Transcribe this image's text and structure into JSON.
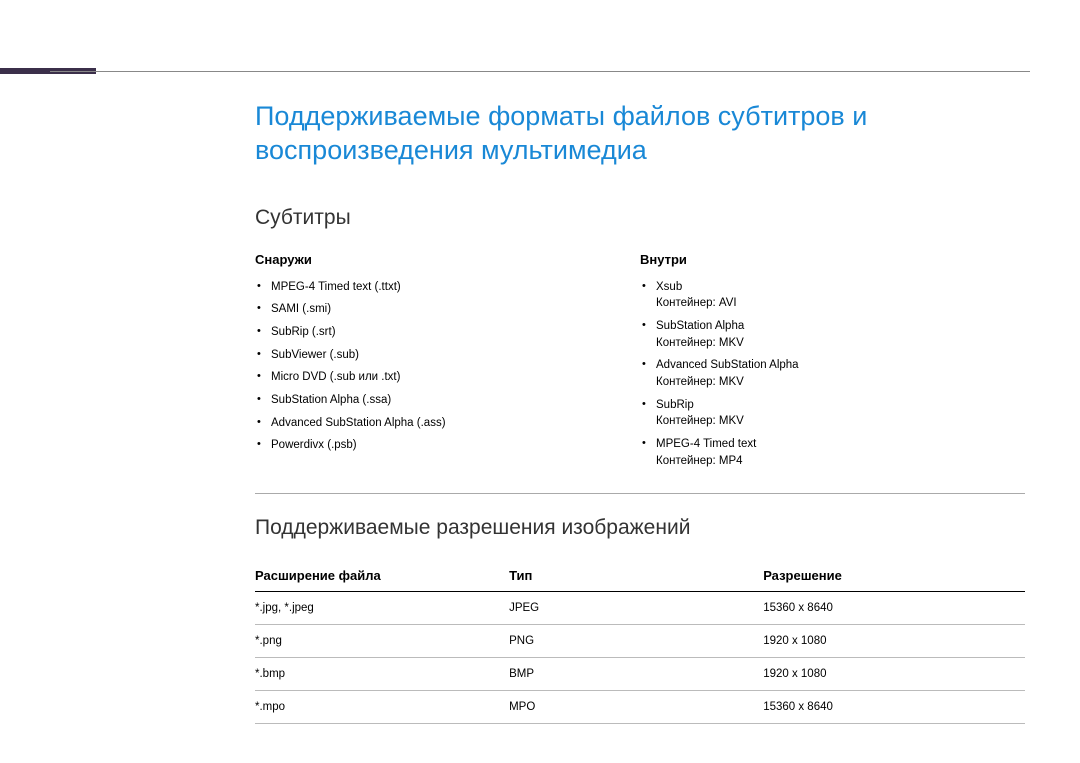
{
  "title": "Поддерживаемые форматы файлов субтитров и воспроизведения мультимедиа",
  "subtitles_heading": "Субтитры",
  "external": {
    "header": "Снаружи",
    "items": [
      "MPEG-4 Timed text (.ttxt)",
      "SAMI (.smi)",
      "SubRip (.srt)",
      "SubViewer (.sub)",
      "Micro DVD (.sub или .txt)",
      "SubStation Alpha (.ssa)",
      "Advanced SubStation Alpha (.ass)",
      "Powerdivx (.psb)"
    ]
  },
  "internal": {
    "header": "Внутри",
    "items": [
      {
        "name": "Xsub",
        "container": "Контейнер: AVI"
      },
      {
        "name": "SubStation Alpha",
        "container": "Контейнер: MKV"
      },
      {
        "name": "Advanced SubStation Alpha",
        "container": "Контейнер: MKV"
      },
      {
        "name": "SubRip",
        "container": "Контейнер: MKV"
      },
      {
        "name": "MPEG-4 Timed text",
        "container": "Контейнер: MP4"
      }
    ]
  },
  "resolutions_heading": "Поддерживаемые разрешения изображений",
  "table": {
    "headers": {
      "ext": "Расширение файла",
      "type": "Тип",
      "res": "Разрешение"
    },
    "rows": [
      {
        "ext": "*.jpg, *.jpeg",
        "type": "JPEG",
        "res": "15360 x 8640"
      },
      {
        "ext": "*.png",
        "type": "PNG",
        "res": "1920 x 1080"
      },
      {
        "ext": "*.bmp",
        "type": "BMP",
        "res": "1920 x 1080"
      },
      {
        "ext": "*.mpo",
        "type": "MPO",
        "res": "15360 x 8640"
      }
    ]
  }
}
